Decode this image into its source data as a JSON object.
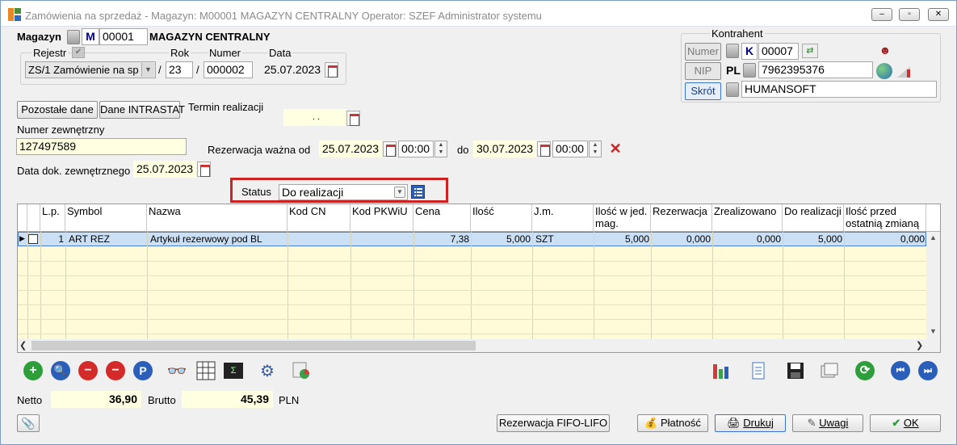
{
  "window": {
    "title": "Zamówienia na sprzedaż - Magazyn: M00001 MAGAZYN CENTRALNY  Operator: SZEF Administrator systemu",
    "minimize": "–",
    "maximize": "▫",
    "close": "✕"
  },
  "magazyn": {
    "label": "Magazyn",
    "type": "M",
    "code": "00001",
    "name": "MAGAZYN CENTRALNY"
  },
  "rejestr": {
    "label": "Rejestr",
    "value": "ZS/1 Zamówienie na sp",
    "rok_label": "Rok",
    "rok": "23",
    "numer_label": "Numer",
    "numer": "000002",
    "data_label": "Data",
    "data": "25.07.2023",
    "sep": "/"
  },
  "kontrahent": {
    "label": "Kontrahent",
    "numer_button": "Numer",
    "type": "K",
    "numer": "00007",
    "nip_button": "NIP",
    "nip_prefix": "PL",
    "nip": "7962395376",
    "skrot_button": "Skrót",
    "skrot": "HUMANSOFT"
  },
  "buttons": {
    "pozostale": "Pozostałe dane",
    "intrastat": "Dane INTRASTAT"
  },
  "termin": {
    "label": "Termin realizacji",
    "value": ". ."
  },
  "numer_zewn": {
    "label": "Numer zewnętrzny",
    "value": "127497589"
  },
  "rezerwacja": {
    "label": "Rezerwacja  ważna od",
    "od_date": "25.07.2023",
    "od_time": "00:00",
    "do_label": "do",
    "do_date": "30.07.2023",
    "do_time": "00:00"
  },
  "data_dok": {
    "label": "Data dok. zewnętrznego",
    "value": "25.07.2023"
  },
  "status": {
    "label": "Status",
    "value": "Do realizacji"
  },
  "table": {
    "headers": [
      "L.p.",
      "Symbol",
      "Nazwa",
      "Kod  CN",
      "Kod  PKWiU",
      "Cena",
      "Ilość",
      "J.m.",
      "Ilość w jed. mag.",
      "Rezerwacja",
      "Zrealizowano",
      "Do realizacji",
      "Ilość przed ostatnią zmianą"
    ],
    "rows": [
      [
        "1",
        "ART REZ",
        "Artykuł rezerwowy pod BL",
        "",
        "",
        "7,38",
        "5,000",
        "SZT",
        "5,000",
        "0,000",
        "0,000",
        "5,000",
        "0,000"
      ]
    ]
  },
  "totals": {
    "netto_label": "Netto",
    "netto": "36,90",
    "brutto_label": "Brutto",
    "brutto": "45,39",
    "currency": "PLN"
  },
  "footer": {
    "fifo": "Rezerwacja FIFO-LIFO",
    "platnosc": "Płatność",
    "drukuj": "Drukuj",
    "uwagi": "Uwagi",
    "ok": "OK"
  },
  "colors": {
    "accent": "#cc2222",
    "selection": "#cce0f5",
    "yellow_field": "#ffffe1"
  }
}
